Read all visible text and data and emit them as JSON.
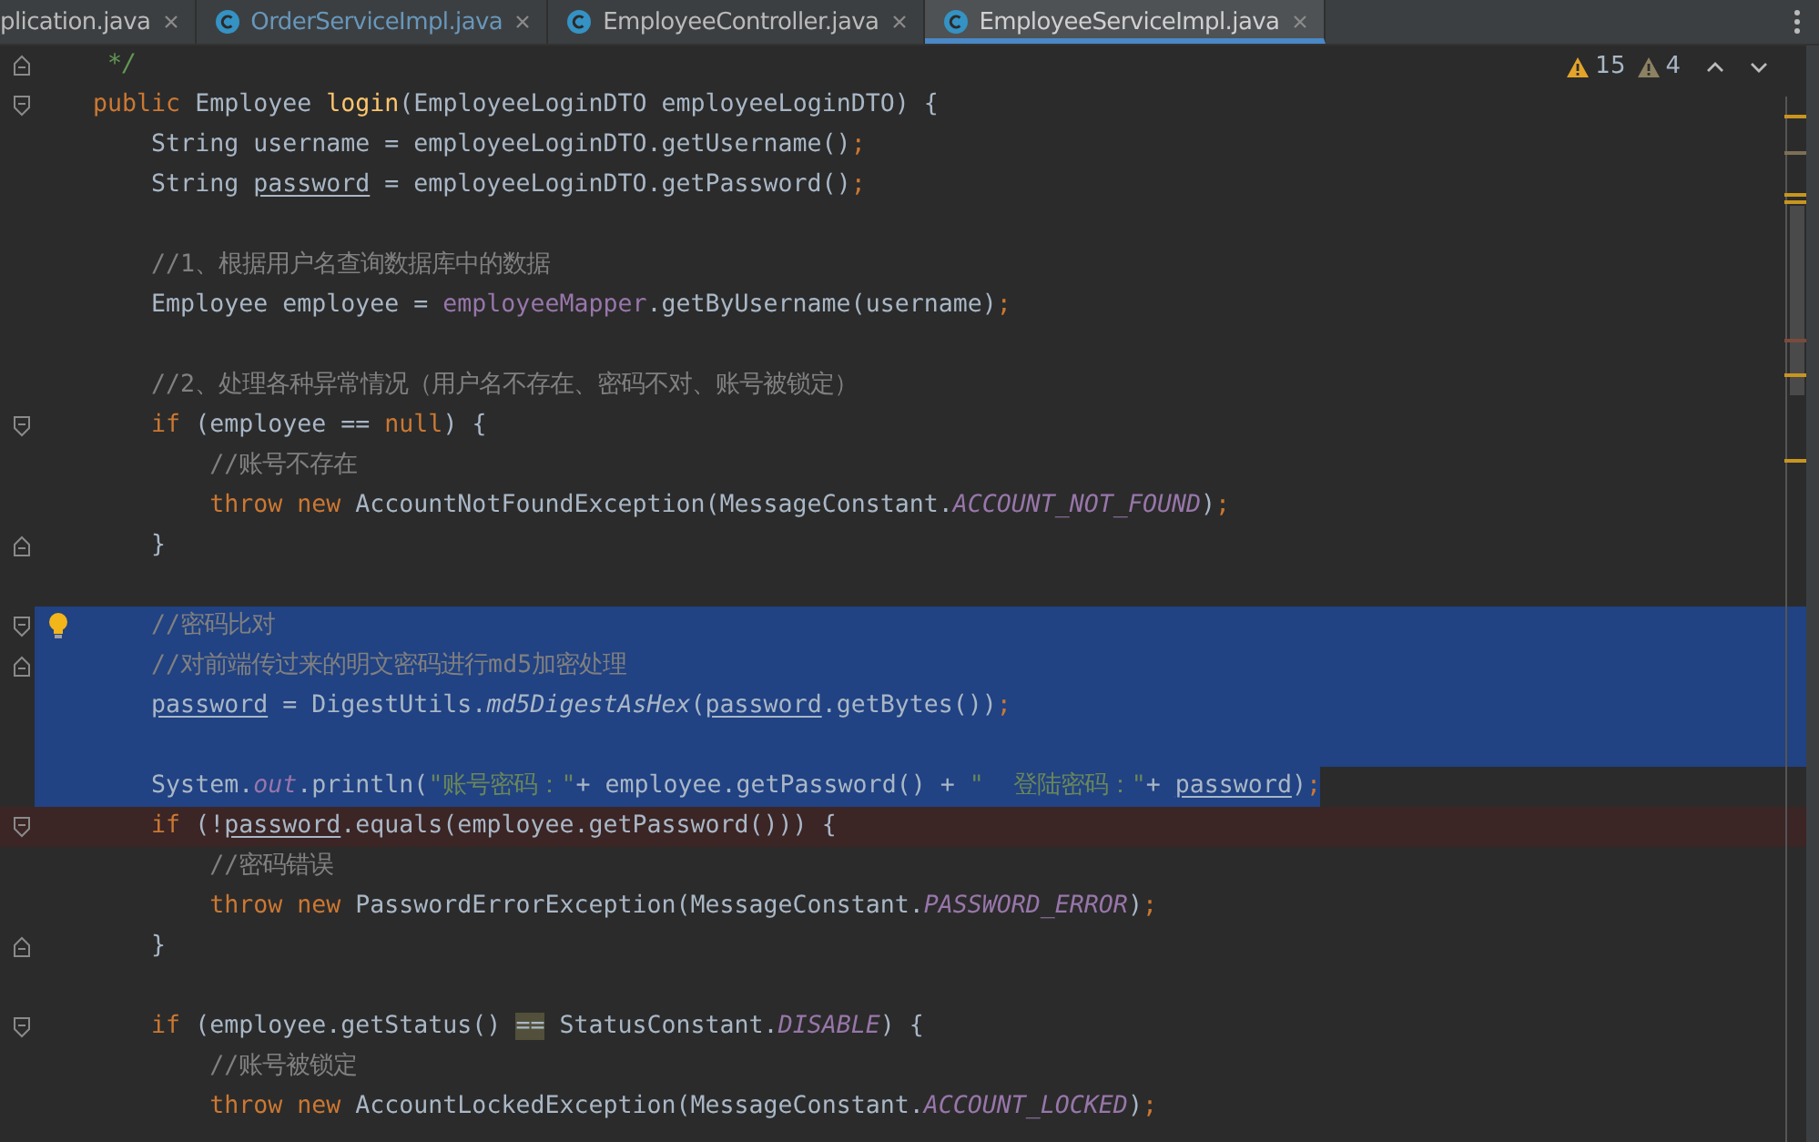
{
  "tabs": [
    {
      "label": "plication.java",
      "icon": false,
      "color": "#bbbbbb",
      "selected": false
    },
    {
      "label": "OrderServiceImpl.java",
      "icon": true,
      "color": "#6897bb",
      "selected": false
    },
    {
      "label": "EmployeeController.java",
      "icon": true,
      "color": "#bbbbbb",
      "selected": false
    },
    {
      "label": "EmployeeServiceImpl.java",
      "icon": true,
      "color": "#d0d0d0",
      "selected": true
    }
  ],
  "inspections": {
    "warnings": "15",
    "weak_warnings": "4"
  },
  "lines": [
    {
      "kind": "code",
      "fold": {
        "kind": "end"
      },
      "tokens": [
        {
          "kind": "doc",
          "t": "     */"
        }
      ]
    },
    {
      "kind": "code",
      "fold": {
        "kind": "start"
      },
      "tokens": [
        {
          "kind": "keyword",
          "t": "    public "
        },
        {
          "kind": "plain",
          "t": "Employee "
        },
        {
          "kind": "function",
          "t": "login"
        },
        {
          "kind": "plain",
          "t": "(EmployeeLoginDTO employeeLoginDTO) {"
        }
      ]
    },
    {
      "kind": "code",
      "tokens": [
        {
          "kind": "plain",
          "t": "        String username = employeeLoginDTO.getUsername()"
        },
        {
          "kind": "keyword",
          "t": ";"
        }
      ]
    },
    {
      "kind": "code",
      "tokens": [
        {
          "kind": "plain",
          "t": "        String "
        },
        {
          "kind": "reassigned",
          "t": "password"
        },
        {
          "kind": "plain",
          "t": " = employeeLoginDTO.getPassword()"
        },
        {
          "kind": "keyword",
          "t": ";"
        }
      ]
    },
    {
      "kind": "blank"
    },
    {
      "kind": "code",
      "tokens": [
        {
          "kind": "comment",
          "t": "        //1、根据用户名查询数据库中的数据"
        }
      ]
    },
    {
      "kind": "code",
      "tokens": [
        {
          "kind": "plain",
          "t": "        Employee employee = "
        },
        {
          "kind": "field",
          "t": "employeeMapper"
        },
        {
          "kind": "plain",
          "t": ".getByUsername(username)"
        },
        {
          "kind": "keyword",
          "t": ";"
        }
      ]
    },
    {
      "kind": "blank"
    },
    {
      "kind": "code",
      "tokens": [
        {
          "kind": "comment",
          "t": "        //2、处理各种异常情况（用户名不存在、密码不对、账号被锁定）"
        }
      ]
    },
    {
      "kind": "code",
      "fold": {
        "kind": "start"
      },
      "tokens": [
        {
          "kind": "keyword",
          "t": "        if "
        },
        {
          "kind": "plain",
          "t": "(employee == "
        },
        {
          "kind": "keyword",
          "t": "null"
        },
        {
          "kind": "plain",
          "t": ") {"
        }
      ]
    },
    {
      "kind": "code",
      "tokens": [
        {
          "kind": "comment",
          "t": "            //账号不存在"
        }
      ]
    },
    {
      "kind": "code",
      "tokens": [
        {
          "kind": "keyword",
          "t": "            throw new "
        },
        {
          "kind": "plain",
          "t": "AccountNotFoundException(MessageConstant."
        },
        {
          "kind": "static",
          "t": "ACCOUNT_NOT_FOUND"
        },
        {
          "kind": "plain",
          "t": ")"
        },
        {
          "kind": "keyword",
          "t": ";"
        }
      ]
    },
    {
      "kind": "code",
      "fold": {
        "kind": "end"
      },
      "tokens": [
        {
          "kind": "plain",
          "t": "        }"
        }
      ]
    },
    {
      "kind": "blank"
    },
    {
      "kind": "code",
      "fold": {
        "kind": "start"
      },
      "bulb": true,
      "highlight": {
        "kind": "selection"
      },
      "tokens": [
        {
          "kind": "comment",
          "t": "        //密码比对"
        }
      ]
    },
    {
      "kind": "code",
      "fold": {
        "kind": "end"
      },
      "highlight": {
        "kind": "selection"
      },
      "tokens": [
        {
          "kind": "comment",
          "t": "        //对前端传过来的明文密码进行md5加密处理"
        }
      ]
    },
    {
      "kind": "code",
      "highlight": {
        "kind": "selection"
      },
      "tokens": [
        {
          "kind": "reassigned",
          "t": "        password"
        },
        {
          "kind": "plain",
          "t": " = DigestUtils."
        },
        {
          "kind": "static-method",
          "t": "md5DigestAsHex"
        },
        {
          "kind": "plain",
          "t": "("
        },
        {
          "kind": "reassigned",
          "t": "password"
        },
        {
          "kind": "plain",
          "t": ".getBytes())"
        },
        {
          "kind": "keyword",
          "t": ";"
        }
      ]
    },
    {
      "kind": "blank",
      "highlight": {
        "kind": "selection"
      }
    },
    {
      "kind": "code",
      "highlight": {
        "kind": "selection-text"
      },
      "tokens": [
        {
          "kind": "plain",
          "t": "        System."
        },
        {
          "kind": "static",
          "t": "out"
        },
        {
          "kind": "plain",
          "t": ".println("
        },
        {
          "kind": "string",
          "t": "\"账号密码：\""
        },
        {
          "kind": "plain",
          "t": "+ employee.getPassword() + "
        },
        {
          "kind": "string",
          "t": "\"  登陆密码：\""
        },
        {
          "kind": "plain",
          "t": "+ "
        },
        {
          "kind": "reassigned",
          "t": "password"
        },
        {
          "kind": "plain",
          "t": ")"
        },
        {
          "kind": "keyword",
          "t": ";"
        }
      ]
    },
    {
      "kind": "code",
      "fold": {
        "kind": "start"
      },
      "highlight": {
        "kind": "error"
      },
      "tokens": [
        {
          "kind": "keyword",
          "t": "        if "
        },
        {
          "kind": "plain",
          "t": "(!"
        },
        {
          "kind": "reassigned",
          "t": "password"
        },
        {
          "kind": "plain",
          "t": ".equals(employee.getPassword())) {"
        }
      ]
    },
    {
      "kind": "code",
      "tokens": [
        {
          "kind": "comment",
          "t": "            //密码错误"
        }
      ]
    },
    {
      "kind": "code",
      "tokens": [
        {
          "kind": "keyword",
          "t": "            throw new "
        },
        {
          "kind": "plain",
          "t": "PasswordErrorException(MessageConstant."
        },
        {
          "kind": "static",
          "t": "PASSWORD_ERROR"
        },
        {
          "kind": "plain",
          "t": ")"
        },
        {
          "kind": "keyword",
          "t": ";"
        }
      ]
    },
    {
      "kind": "code",
      "fold": {
        "kind": "end"
      },
      "tokens": [
        {
          "kind": "plain",
          "t": "        }"
        }
      ]
    },
    {
      "kind": "blank"
    },
    {
      "kind": "code",
      "fold": {
        "kind": "start"
      },
      "tokens": [
        {
          "kind": "keyword",
          "t": "        if "
        },
        {
          "kind": "plain",
          "t": "(employee.getStatus() "
        },
        {
          "kind": "match",
          "t": "=="
        },
        {
          "kind": "plain",
          "t": " StatusConstant."
        },
        {
          "kind": "static",
          "t": "DISABLE"
        },
        {
          "kind": "plain",
          "t": ") {"
        }
      ]
    },
    {
      "kind": "code",
      "tokens": [
        {
          "kind": "comment",
          "t": "            //账号被锁定"
        }
      ]
    },
    {
      "kind": "code",
      "tokens": [
        {
          "kind": "keyword",
          "t": "            throw new "
        },
        {
          "kind": "plain",
          "t": "AccountLockedException(MessageConstant."
        },
        {
          "kind": "static",
          "t": "ACCOUNT_LOCKED"
        },
        {
          "kind": "plain",
          "t": ")"
        },
        {
          "kind": "keyword",
          "t": ";"
        }
      ]
    }
  ]
}
